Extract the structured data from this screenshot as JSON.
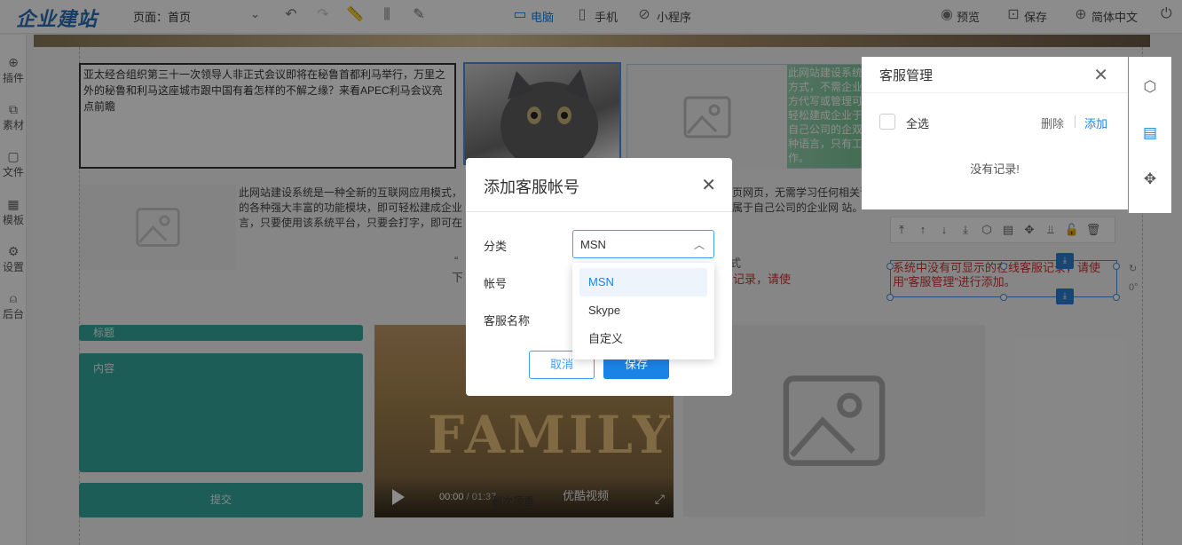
{
  "app": {
    "logo": "企业建站"
  },
  "topbar": {
    "page_label": "页面：",
    "page_value": "首页",
    "device_desktop": "电脑",
    "device_mobile": "手机",
    "device_mini": "小程序",
    "preview": "预览",
    "save": "保存",
    "language": "简体中文"
  },
  "sidebar": {
    "items": [
      {
        "label": "插件",
        "icon": "plus-circle-icon"
      },
      {
        "label": "素材",
        "icon": "material-icon"
      },
      {
        "label": "文件",
        "icon": "folder-icon"
      },
      {
        "label": "模板",
        "icon": "grid-icon"
      },
      {
        "label": "设置",
        "icon": "gear-icon"
      },
      {
        "label": "后台",
        "icon": "user-icon"
      }
    ]
  },
  "canvas": {
    "news_text": "亚太经合组织第三十一次领导人非正式会议即将在秘鲁首都利马举行，万里之外的秘鲁和利马这座城市跟中国有着怎样的不解之缘？来看APEC利马会议亮点前瞻",
    "green_text": "此网站建设系统方式，不需企业方代写或管理可轻松建成企业于自己公司的企双种语言，只有工作。",
    "paragraph_left": "此网站建设系统是一种全新的互联网应用模式，\n的各种强大丰富的功能模块，即可轻松建成企业\n言，只要使用该系统平台，只要会打字，即可在",
    "paragraph_right": "页网页，无需学习任何相关语\n属于自己公司的企业网 站。",
    "quote_frag1": "“",
    "quote_frag2": "式",
    "quote_frag3": "下",
    "red_frag": "记录，请使",
    "form_title": "标题",
    "form_content": "内容",
    "form_submit": "提交",
    "video_title": "FAMILY",
    "video_time_current": "00:00",
    "video_time_total": "/ 01:37",
    "video_brand": "优酷视频",
    "video_sub": "删次顶重",
    "red_notice": "系统中没有可显示的在线客服记录，请使用“客服管理”进行添加。",
    "rotation": "0°"
  },
  "cs_panel": {
    "title": "客服管理",
    "select_all": "全选",
    "delete": "删除",
    "add": "添加",
    "empty": "没有记录!"
  },
  "modal": {
    "title": "添加客服帐号",
    "label_category": "分类",
    "label_account": "帐号",
    "label_name": "客服名称",
    "select_value": "MSN",
    "cancel": "取消",
    "save": "保存",
    "options": [
      "MSN",
      "Skype",
      "自定义"
    ]
  },
  "colors": {
    "accent": "#1a84e6",
    "form_teal": "#36a9a0",
    "notice_red": "#c33333"
  }
}
